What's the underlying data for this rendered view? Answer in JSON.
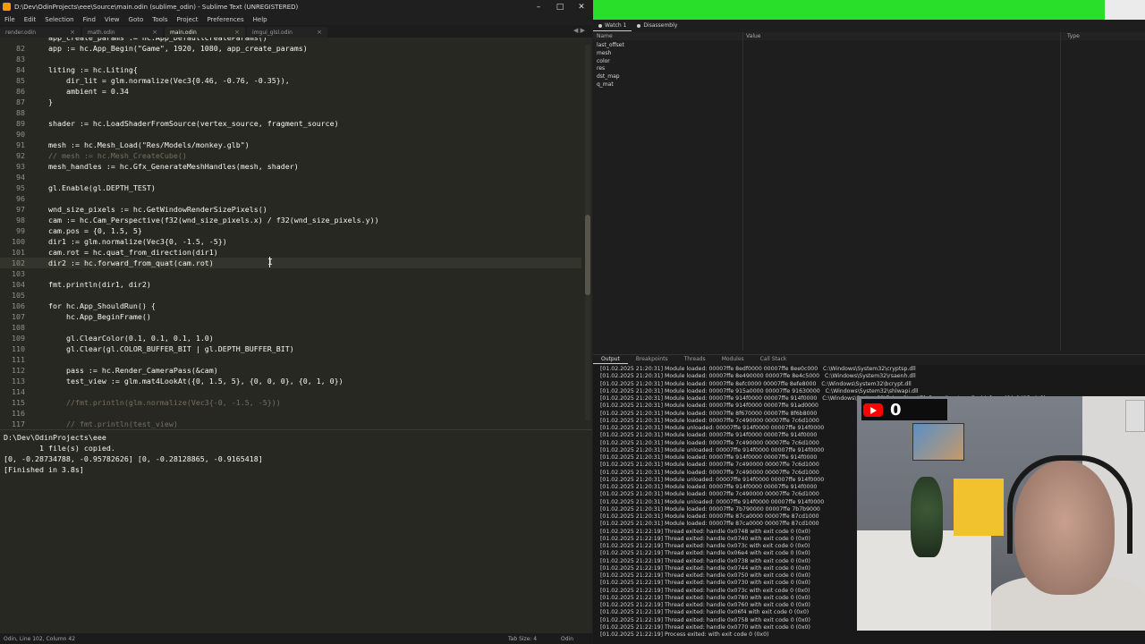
{
  "sublime": {
    "window_title": "D:\\Dev\\OdinProjects\\eee\\Source\\main.odin (sublime_odin) - Sublime Text (UNREGISTERED)",
    "menu": [
      "File",
      "Edit",
      "Selection",
      "Find",
      "View",
      "Goto",
      "Tools",
      "Project",
      "Preferences",
      "Help"
    ],
    "tabs": [
      {
        "label": "render.odin"
      },
      {
        "label": "math.odin"
      },
      {
        "label": "main.odin"
      },
      {
        "label": "imgui_glsl.odin"
      }
    ],
    "code_lines": [
      {
        "n": "",
        "text": "    app_create_params := hc.App_DefaultCreateParams()"
      },
      {
        "n": "82",
        "text": "    app := hc.App_Begin(\"Game\", 1920, 1080, app_create_params)"
      },
      {
        "n": "83",
        "text": ""
      },
      {
        "n": "84",
        "text": "    liting := hc.Liting{"
      },
      {
        "n": "85",
        "text": "        dir_lit = glm.normalize(Vec3{0.46, -0.76, -0.35}),"
      },
      {
        "n": "86",
        "text": "        ambient = 0.34"
      },
      {
        "n": "87",
        "text": "    }"
      },
      {
        "n": "88",
        "text": ""
      },
      {
        "n": "89",
        "text": "    shader := hc.LoadShaderFromSource(vertex_source, fragment_source)"
      },
      {
        "n": "90",
        "text": ""
      },
      {
        "n": "91",
        "text": "    mesh := hc.Mesh_Load(\"Res/Models/monkey.glb\")"
      },
      {
        "n": "92",
        "text": "    // mesh := hc.Mesh_CreateCube()"
      },
      {
        "n": "93",
        "text": "    mesh_handles := hc.Gfx_GenerateMeshHandles(mesh, shader)"
      },
      {
        "n": "94",
        "text": ""
      },
      {
        "n": "95",
        "text": "    gl.Enable(gl.DEPTH_TEST)"
      },
      {
        "n": "96",
        "text": ""
      },
      {
        "n": "97",
        "text": "    wnd_size_pixels := hc.GetWindowRenderSizePixels()"
      },
      {
        "n": "98",
        "text": "    cam := hc.Cam_Perspective(f32(wnd_size_pixels.x) / f32(wnd_size_pixels.y))"
      },
      {
        "n": "99",
        "text": "    cam.pos = {0, 1.5, 5}"
      },
      {
        "n": "100",
        "text": "    dir1 := glm.normalize(Vec3{0, -1.5, -5})"
      },
      {
        "n": "101",
        "text": "    cam.rot = hc.quat_from_direction(dir1)"
      },
      {
        "n": "102",
        "text": "    dir2 := hc.forward_from_quat(cam.rot)"
      },
      {
        "n": "103",
        "text": ""
      },
      {
        "n": "104",
        "text": "    fmt.println(dir1, dir2)"
      },
      {
        "n": "105",
        "text": ""
      },
      {
        "n": "106",
        "text": "    for hc.App_ShouldRun() {"
      },
      {
        "n": "107",
        "text": "        hc.App_BeginFrame()"
      },
      {
        "n": "108",
        "text": ""
      },
      {
        "n": "109",
        "text": "        gl.ClearColor(0.1, 0.1, 0.1, 1.0)"
      },
      {
        "n": "110",
        "text": "        gl.Clear(gl.COLOR_BUFFER_BIT | gl.DEPTH_BUFFER_BIT)"
      },
      {
        "n": "111",
        "text": ""
      },
      {
        "n": "112",
        "text": "        pass := hc.Render_CameraPass(&cam)"
      },
      {
        "n": "113",
        "text": "        test_view := glm.mat4LookAt({0, 1.5, 5}, {0, 0, 0}, {0, 1, 0})"
      },
      {
        "n": "114",
        "text": ""
      },
      {
        "n": "115",
        "text": "        //fmt.println(glm.normalize(Vec3{-0, -1.5, -5}))"
      },
      {
        "n": "116",
        "text": ""
      },
      {
        "n": "117",
        "text": "        // fmt.println(test_view)"
      }
    ],
    "build_output": [
      "D:\\Dev\\OdinProjects\\eee",
      "        1 file(s) copied.",
      "[0, -0.28734788, -0.95782626] [0, -0.28128865, -0.9165418]",
      "[Finished in 3.8s]"
    ],
    "status": {
      "left": "Odin, Line 102, Column 42",
      "tab_size": "Tab Size: 4",
      "syntax": "Odin"
    }
  },
  "debugger": {
    "watch_tabs": [
      "Watch 1",
      "Disassembly"
    ],
    "watch_columns": [
      "Name",
      "Value",
      "Type"
    ],
    "watch_rows": [
      "last_offset",
      "mesh",
      "color",
      "res",
      "dst_map",
      "q_mat"
    ],
    "output_tabs": [
      "Output",
      "Breakpoints",
      "Threads",
      "Modules",
      "Call Stack"
    ],
    "output_lines": [
      "[01.02.2025 21:20:31] Module loaded: 00007ffe 8edf0000 00007ffe 8ee0c000   C:\\Windows\\System32\\cryptsp.dll",
      "[01.02.2025 21:20:31] Module loaded: 00007ffe 8e490000 00007ffe 8e4c5000   C:\\Windows\\System32\\rsaenh.dll",
      "[01.02.2025 21:20:31] Module loaded: 00007ffe 8efc0000 00007ffe 8efe8000   C:\\Windows\\System32\\bcrypt.dll",
      "[01.02.2025 21:20:31] Module loaded: 00007ffe 915a0000 00007ffe 91630000   C:\\Windows\\System32\\shlwapi.dll",
      "[01.02.2025 21:20:31] Module loaded: 00007ffe 914f0000 00007ffe 914f0000   C:\\Windows\\System32\\DriverStore\\FileRepository\\nv_dispi.inf_amd64_9425e4c3b",
      "[01.02.2025 21:20:31] Module loaded: 00007ffe 914f0000 00007ffe 91ad0000",
      "[01.02.2025 21:20:31] Module loaded: 00007ffe 8f670000 00007ffe 8f6b8000",
      "[01.02.2025 21:20:31] Module loaded: 00007ffe 7c490000 00007ffe 7c6d1000",
      "[01.02.2025 21:20:31] Module unloaded: 00007ffe 914f0000 00007ffe 914f0000",
      "[01.02.2025 21:20:31] Module loaded: 00007ffe 914f0000 00007ffe 914f0000",
      "[01.02.2025 21:20:31] Module loaded: 00007ffe 7c490000 00007ffe 7c6d1000",
      "[01.02.2025 21:20:31] Module unloaded: 00007ffe 914f0000 00007ffe 914f0000",
      "[01.02.2025 21:20:31] Module loaded: 00007ffe 914f0000 00007ffe 914f0000",
      "[01.02.2025 21:20:31] Module loaded: 00007ffe 7c490000 00007ffe 7c6d1000",
      "[01.02.2025 21:20:31] Module loaded: 00007ffe 7c490000 00007ffe 7c6d1000",
      "[01.02.2025 21:20:31] Module unloaded: 00007ffe 914f0000 00007ffe 914f0000",
      "[01.02.2025 21:20:31] Module loaded: 00007ffe 914f0000 00007ffe 914f0000",
      "[01.02.2025 21:20:31] Module loaded: 00007ffe 7c490000 00007ffe 7c6d1000",
      "[01.02.2025 21:20:31] Module unloaded: 00007ffe 914f0000 00007ffe 914f0000",
      "[01.02.2025 21:20:31] Module loaded: 00007ffe 7b790000 00007ffe 7b7b9000",
      "[01.02.2025 21:20:31] Module loaded: 00007ffe 87ca0000 00007ffe 87cd1000",
      "[01.02.2025 21:20:31] Module loaded: 00007ffe 87ca0000 00007ffe 87cd1000",
      "[01.02.2025 21:22:19] Thread exited: handle 0x0748 with exit code 0 (0x0)",
      "[01.02.2025 21:22:19] Thread exited: handle 0x0740 with exit code 0 (0x0)",
      "[01.02.2025 21:22:19] Thread exited: handle 0x073c with exit code 0 (0x0)",
      "[01.02.2025 21:22:19] Thread exited: handle 0x06e4 with exit code 0 (0x0)",
      "[01.02.2025 21:22:19] Thread exited: handle 0x0738 with exit code 0 (0x0)",
      "[01.02.2025 21:22:19] Thread exited: handle 0x0744 with exit code 0 (0x0)",
      "[01.02.2025 21:22:19] Thread exited: handle 0x0750 with exit code 0 (0x0)",
      "[01.02.2025 21:22:19] Thread exited: handle 0x0730 with exit code 0 (0x0)",
      "[01.02.2025 21:22:19] Thread exited: handle 0x073c with exit code 0 (0x0)",
      "[01.02.2025 21:22:19] Thread exited: handle 0x0780 with exit code 0 (0x0)",
      "[01.02.2025 21:22:19] Thread exited: handle 0x0760 with exit code 0 (0x0)",
      "[01.02.2025 21:22:19] Thread exited: handle 0x06f4 with exit code 0 (0x0)",
      "[01.02.2025 21:22:19] Thread exited: handle 0x0758 with exit code 0 (0x0)",
      "[01.02.2025 21:22:19] Thread exited: handle 0x0770 with exit code 0 (0x0)",
      "[01.02.2025 21:22:19] Process exited: with exit code 0 (0x0)"
    ]
  },
  "webcam": {
    "badge_count": "0"
  }
}
